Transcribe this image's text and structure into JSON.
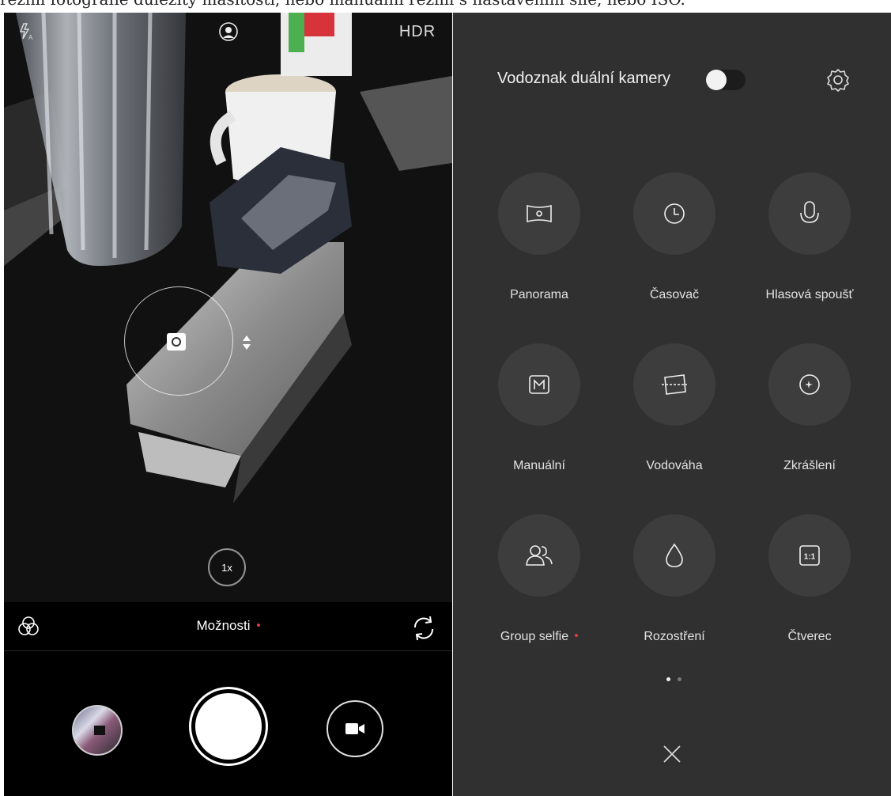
{
  "caption": "režim fotografie důležitý masitosti, nebo manuální režim s nastavením síle, nebo ISO.",
  "camera": {
    "hdr_label": "HDR",
    "zoom_label": "1x",
    "options_label": "Možnosti",
    "icons": [
      "flash-auto-icon",
      "portrait-icon",
      "filters-icon",
      "switch-camera-icon",
      "video-icon",
      "camera-icon"
    ]
  },
  "panel": {
    "watermark_label": "Vodoznak duální kamery",
    "watermark_enabled": false,
    "tiles": [
      {
        "label": "Panorama",
        "icon": "panorama-icon",
        "badge": false
      },
      {
        "label": "Časovač",
        "icon": "timer-icon",
        "badge": false
      },
      {
        "label": "Hlasová spoušť",
        "icon": "microphone-icon",
        "badge": false
      },
      {
        "label": "Manuální",
        "icon": "manual-icon",
        "badge": false
      },
      {
        "label": "Vodováha",
        "icon": "level-icon",
        "badge": false
      },
      {
        "label": "Zkrášlení",
        "icon": "beautify-icon",
        "badge": false
      },
      {
        "label": "Group selfie",
        "icon": "group-icon",
        "badge": true
      },
      {
        "label": "Rozostření",
        "icon": "drop-icon",
        "badge": false
      },
      {
        "label": "Čtverec",
        "icon": "square-icon",
        "badge": false
      }
    ],
    "square_icon_text": "1:1",
    "page_indicator": {
      "count": 2,
      "active": 1
    }
  },
  "colors": {
    "panel_bg": "#303030",
    "tile_bg": "#3d3d3d",
    "badge_red": "#e63a3a"
  }
}
